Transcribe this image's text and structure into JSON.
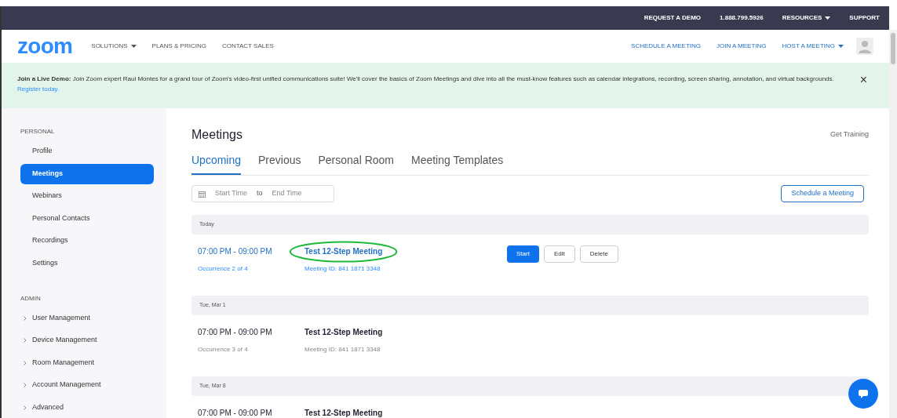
{
  "top_bar": {
    "links": [
      {
        "label": "REQUEST A DEMO",
        "dropdown": false
      },
      {
        "label": "1.888.799.5926",
        "dropdown": false
      },
      {
        "label": "RESOURCES",
        "dropdown": true
      },
      {
        "label": "SUPPORT",
        "dropdown": false
      }
    ]
  },
  "nav": {
    "logo": "zoom",
    "links": [
      {
        "label": "SOLUTIONS",
        "dropdown": true
      },
      {
        "label": "PLANS & PRICING",
        "dropdown": false
      },
      {
        "label": "CONTACT SALES",
        "dropdown": false
      }
    ],
    "actions": [
      {
        "label": "SCHEDULE A MEETING",
        "dropdown": false
      },
      {
        "label": "JOIN A MEETING",
        "dropdown": false
      },
      {
        "label": "HOST A MEETING",
        "dropdown": true
      }
    ]
  },
  "banner": {
    "text": "**Join a Live Demo:** Join Zoom expert Raul Montes for a grand tour of Zoom's video-first unified communications suite! We'll cover the basics of Zoom Meetings and dive into all the must-know features such as calendar integrations, recording, screen sharing, annotation, and virtual backgrounds.",
    "link": "Register today.",
    "close": "×"
  },
  "sidebar": {
    "sections": [
      {
        "title": "PERSONAL",
        "items": [
          {
            "label": "Profile",
            "selected": false,
            "expandable": false
          },
          {
            "label": "Meetings",
            "selected": true,
            "expandable": false
          },
          {
            "label": "Webinars",
            "selected": false,
            "expandable": false
          },
          {
            "label": "Personal Contacts",
            "selected": false,
            "expandable": false
          },
          {
            "label": "Recordings",
            "selected": false,
            "expandable": false
          },
          {
            "label": "Settings",
            "selected": false,
            "expandable": false
          }
        ]
      },
      {
        "title": "ADMIN",
        "items": [
          {
            "label": "User Management",
            "selected": false,
            "expandable": true
          },
          {
            "label": "Device Management",
            "selected": false,
            "expandable": true
          },
          {
            "label": "Room Management",
            "selected": false,
            "expandable": true
          },
          {
            "label": "Account Management",
            "selected": false,
            "expandable": true
          },
          {
            "label": "Advanced",
            "selected": false,
            "expandable": true
          }
        ]
      }
    ]
  },
  "main": {
    "title": "Meetings",
    "training_link": "Get Training",
    "tabs": [
      {
        "label": "Upcoming",
        "selected": true
      },
      {
        "label": "Previous",
        "selected": false
      },
      {
        "label": "Personal Room",
        "selected": false
      },
      {
        "label": "Meeting Templates",
        "selected": false
      }
    ],
    "date_range": {
      "start_placeholder": "Start Time",
      "separator": "to",
      "end_placeholder": "End Time"
    },
    "schedule_button": "Schedule a Meeting",
    "groups": [
      {
        "date": "Today",
        "meetings": [
          {
            "time": "07:00 PM - 09:00 PM",
            "occurrence": "Occurrence 2 of 4",
            "topic": "Test 12-Step Meeting",
            "meeting_id": "Meeting ID: 841 1871 3348",
            "highlighted": true,
            "circled": true,
            "buttons": [
              {
                "label": "Start",
                "kind": "primary"
              },
              {
                "label": "Edit",
                "kind": "outline"
              },
              {
                "label": "Delete",
                "kind": "outline"
              }
            ]
          }
        ]
      },
      {
        "date": "Tue, Mar 1",
        "meetings": [
          {
            "time": "07:00 PM - 09:00 PM",
            "occurrence": "Occurrence 3 of 4",
            "topic": "Test 12-Step Meeting",
            "meeting_id": "Meeting ID: 841 1871 3348",
            "highlighted": false,
            "circled": false
          }
        ]
      },
      {
        "date": "Tue, Mar 8",
        "meetings": [
          {
            "time": "07:00 PM - 09:00 PM",
            "topic": "Test 12-Step Meeting",
            "highlighted": false,
            "circled": false
          }
        ]
      }
    ]
  }
}
